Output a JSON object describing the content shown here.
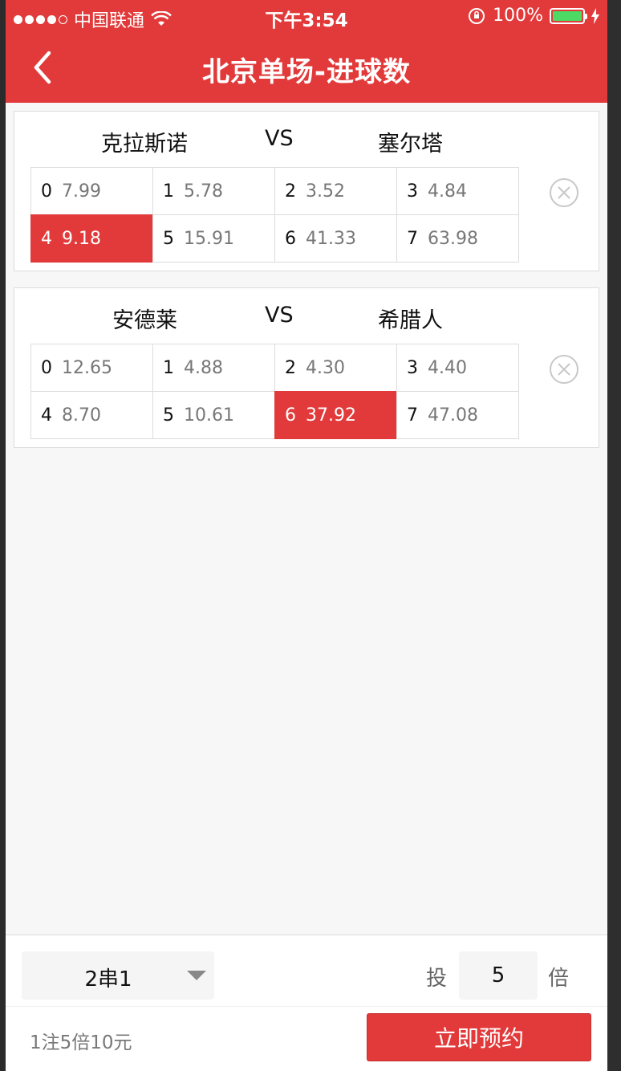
{
  "status_bar": {
    "carrier": "中国联通",
    "time": "下午3:54",
    "battery": "100%",
    "icons": [
      "signal-dots-icon",
      "wifi-icon",
      "rotation-lock-icon",
      "battery-icon",
      "charging-icon"
    ]
  },
  "nav": {
    "title": "北京单场-进球数",
    "back_icon": "chevron-left-icon"
  },
  "matches": [
    {
      "home": "克拉斯诺",
      "vs": "VS",
      "away": "塞尔塔",
      "options": [
        {
          "goals": "0",
          "odds": "7.99",
          "selected": false
        },
        {
          "goals": "1",
          "odds": "5.78",
          "selected": false
        },
        {
          "goals": "2",
          "odds": "3.52",
          "selected": false
        },
        {
          "goals": "3",
          "odds": "4.84",
          "selected": false
        },
        {
          "goals": "4",
          "odds": "9.18",
          "selected": true
        },
        {
          "goals": "5",
          "odds": "15.91",
          "selected": false
        },
        {
          "goals": "6",
          "odds": "41.33",
          "selected": false
        },
        {
          "goals": "7",
          "odds": "63.98",
          "selected": false
        }
      ]
    },
    {
      "home": "安德莱",
      "vs": "VS",
      "away": "希腊人",
      "options": [
        {
          "goals": "0",
          "odds": "12.65",
          "selected": false
        },
        {
          "goals": "1",
          "odds": "4.88",
          "selected": false
        },
        {
          "goals": "2",
          "odds": "4.30",
          "selected": false
        },
        {
          "goals": "3",
          "odds": "4.40",
          "selected": false
        },
        {
          "goals": "4",
          "odds": "8.70",
          "selected": false
        },
        {
          "goals": "5",
          "odds": "10.61",
          "selected": false
        },
        {
          "goals": "6",
          "odds": "37.92",
          "selected": true
        },
        {
          "goals": "7",
          "odds": "47.08",
          "selected": false
        }
      ]
    }
  ],
  "footer": {
    "pass_type": "2串1",
    "bet_label": "投",
    "multiplier": "5",
    "multiplier_unit": "倍",
    "summary": "1注5倍10元",
    "reserve_label": "立即预约"
  },
  "colors": {
    "accent": "#e23a3a",
    "border": "#dcdcdc",
    "text_primary": "#111111",
    "text_odds": "#555555",
    "background": "#f7f7f7"
  }
}
